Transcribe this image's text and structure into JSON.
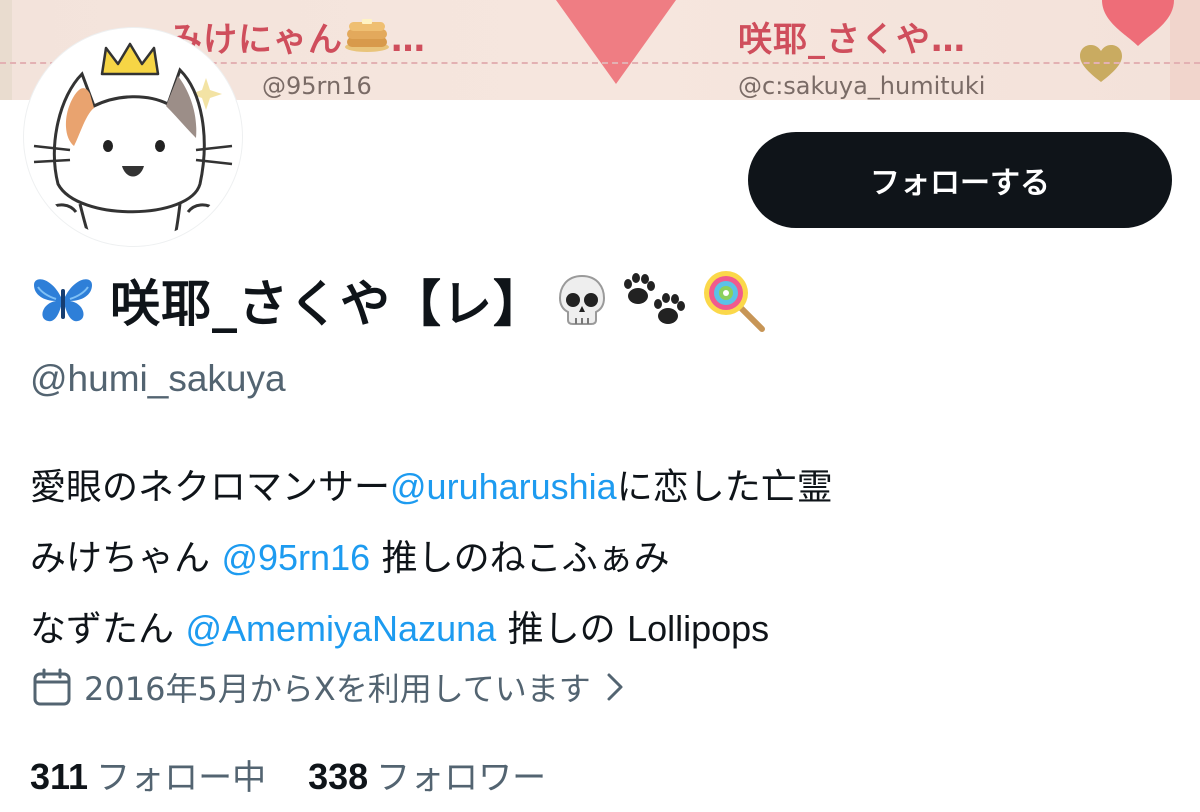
{
  "banner": {
    "left_name": "みけにゃん",
    "left_ellipsis": "…",
    "left_handle": "@95rn16",
    "right_name": "咲耶_さくや…",
    "right_handle": "@c:sakuya_humituki"
  },
  "profile": {
    "follow_label": "フォローする",
    "display_name": "咲耶_さくや【レ】",
    "name_emojis": [
      "butterfly-icon",
      "skull-icon",
      "paw-prints-icon",
      "lollipop-icon"
    ],
    "handle": "@humi_sakuya"
  },
  "bio": {
    "line1": {
      "text1": "愛眼のネクロマンサー",
      "mention": "@uruharushia",
      "text2": "に恋した亡霊"
    },
    "line2": {
      "text1": " みけちゃん",
      "mention": "@95rn16",
      "text2": "推しのねこふぁみ"
    },
    "line3": {
      "text1": "なずたん",
      "mention": "@AmemiyaNazuna",
      "text2": "推しの",
      "latin": "Lollipops"
    }
  },
  "joined": {
    "text": "2016年5月からXを利用しています"
  },
  "stats": {
    "following_count": "311",
    "following_label": "フォロー中",
    "followers_count": "338",
    "followers_label": "フォロワー"
  },
  "colors": {
    "accent": "#1d9bf0",
    "text": "#0f1419",
    "secondary": "#536471",
    "button_bg": "#0f1419",
    "banner_text": "#cf4e5c"
  }
}
